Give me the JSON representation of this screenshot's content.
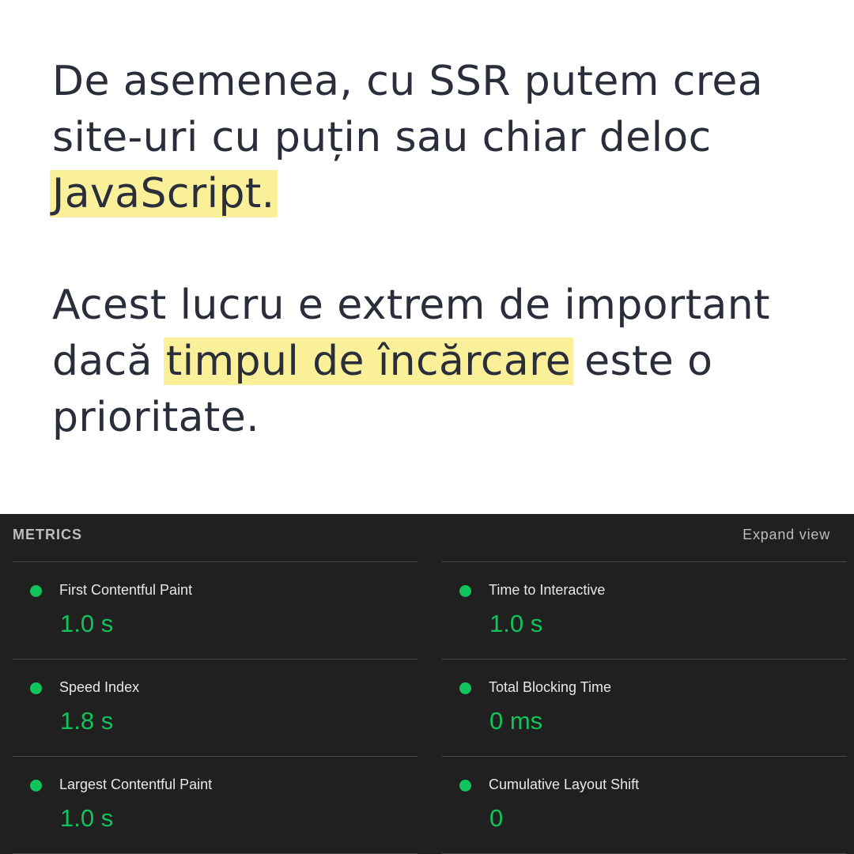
{
  "article": {
    "paragraph1": {
      "line1": "De asemenea, cu SSR putem crea",
      "line2": "site-uri cu puțin sau chiar deloc",
      "highlight": "JavaScript."
    },
    "paragraph2": {
      "line1": "Acest lucru e extrem de important",
      "line2_before": "dacă ",
      "highlight": "timpul de încărcare",
      "line2_after": " este o",
      "line3": "prioritate."
    },
    "highlight_color": "#fbf09a"
  },
  "metrics": {
    "title": "METRICS",
    "expand_label": "Expand view",
    "status_color": "#10c35a",
    "left": [
      {
        "label": "First Contentful Paint",
        "value": "1.0 s"
      },
      {
        "label": "Speed Index",
        "value": "1.8 s"
      },
      {
        "label": "Largest Contentful Paint",
        "value": "1.0 s"
      }
    ],
    "right": [
      {
        "label": "Time to Interactive",
        "value": "1.0 s"
      },
      {
        "label": "Total Blocking Time",
        "value": "0 ms"
      },
      {
        "label": "Cumulative Layout Shift",
        "value": "0"
      }
    ]
  }
}
